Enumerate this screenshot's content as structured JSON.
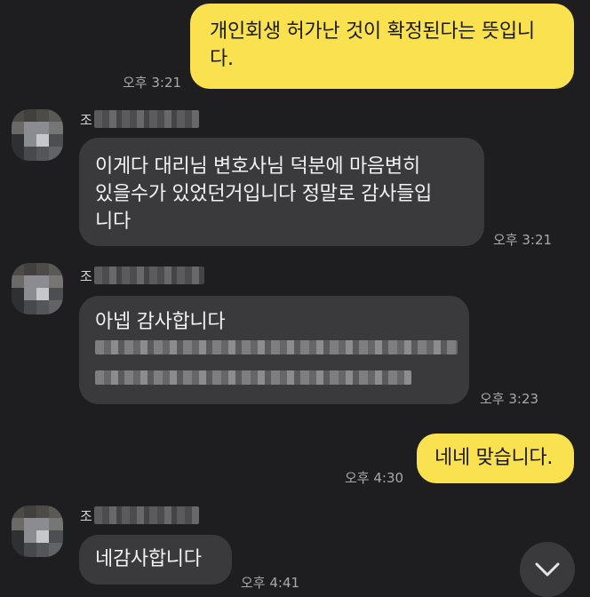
{
  "messages": [
    {
      "from": "me",
      "text": "개인회생 허가난 것이 확정된다는 뜻입니다.",
      "line1": "개인회생 허가난 것이 확정된다는 뜻입니",
      "line2": "다.",
      "time": "오후 3:21"
    },
    {
      "from": "other",
      "sender_initial": "조",
      "line1": "이게다  대리님 변호사님 덕분에 마음변히",
      "line2": "있을수가 있었던거입니다  정말로 감사들입",
      "line3": "니다",
      "time": "오후 3:21"
    },
    {
      "from": "other",
      "sender_initial": "조",
      "line1": "아넵 감사합니다",
      "time": "오후 3:23"
    },
    {
      "from": "me",
      "line1": "네네 맞습니다.",
      "time": "오후 4:30"
    },
    {
      "from": "other",
      "sender_initial": "조",
      "line1": "네감사합니다",
      "time": "오후 4:41"
    }
  ],
  "icons": {
    "scroll_down": "chevron-down-icon"
  },
  "colors": {
    "background": "#1e1e20",
    "my_bubble": "#fae14f",
    "their_bubble": "#3a3a3c"
  }
}
